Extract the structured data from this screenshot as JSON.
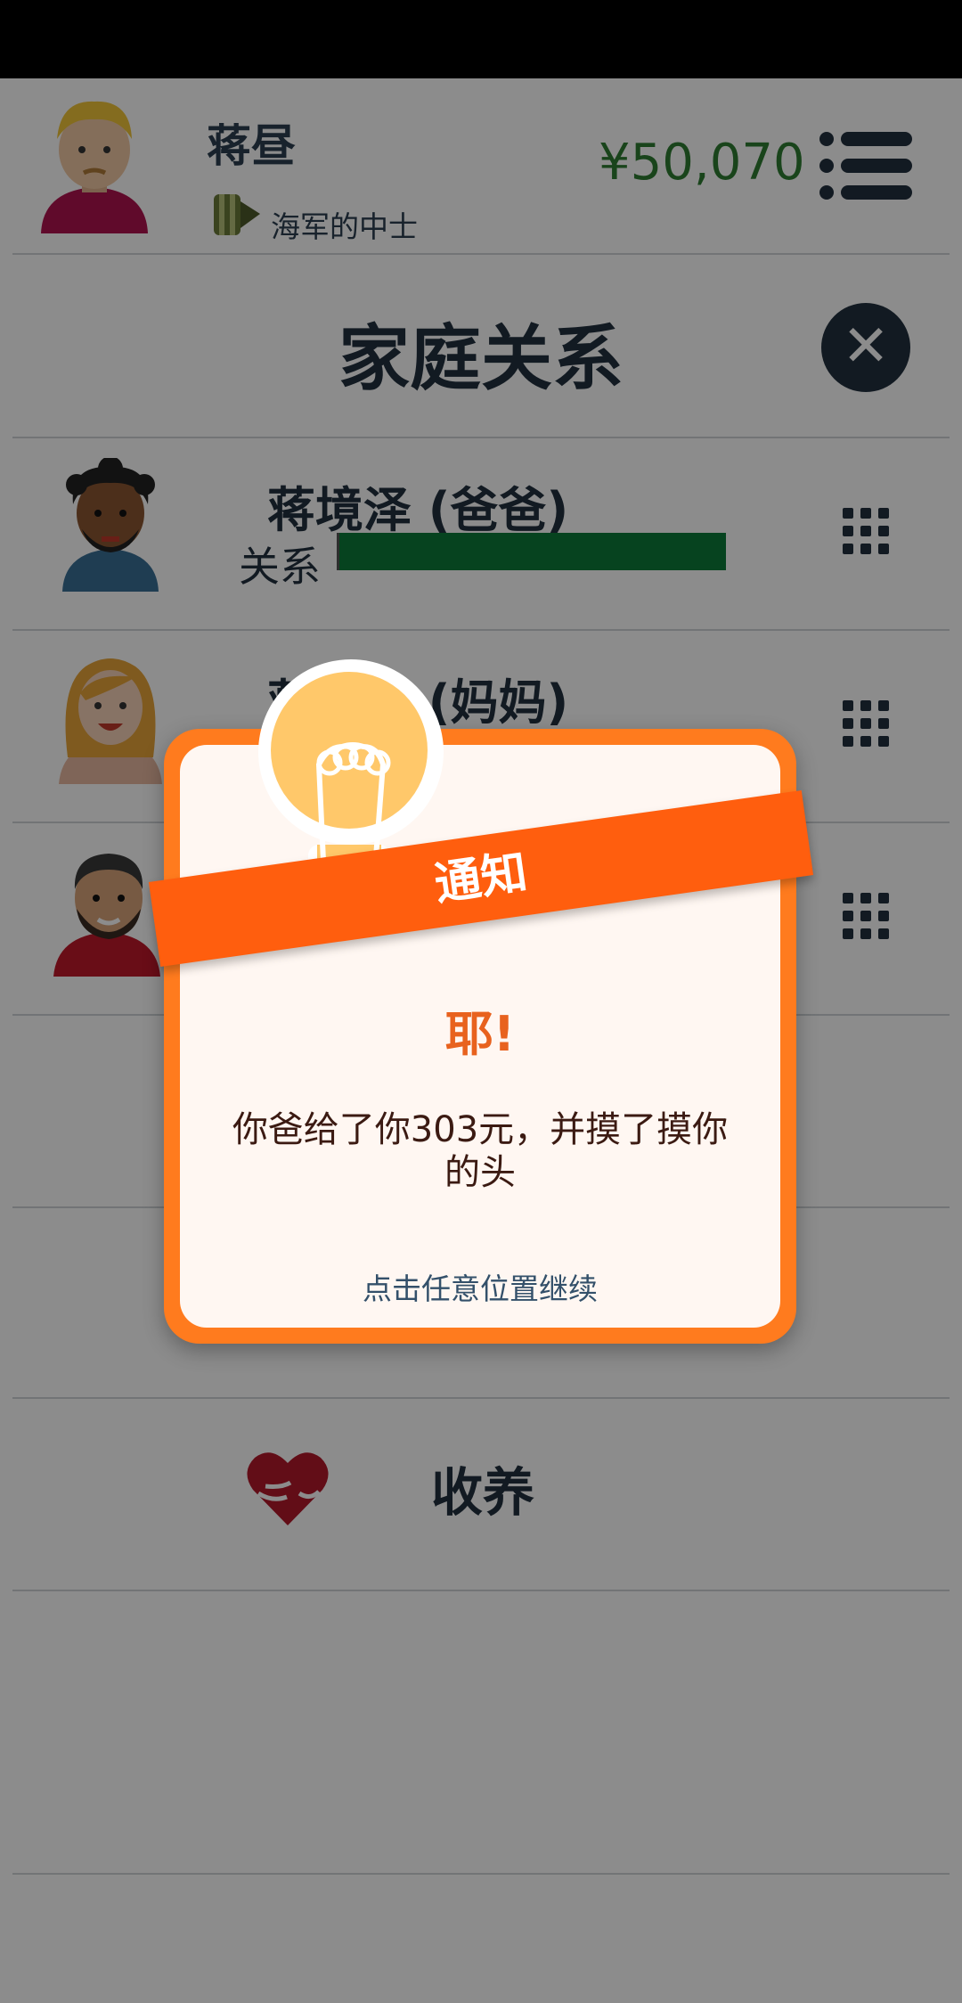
{
  "user": {
    "name": "蒋昼",
    "rank": "海军的中士",
    "money": "¥50,070"
  },
  "page": {
    "title": "家庭关系",
    "close_symbol": "✕"
  },
  "relation_label": "关系",
  "members": [
    {
      "name": "蒋境泽 (爸爸)",
      "relationship": 1.0
    },
    {
      "name": "蒋　泽 (妈妈)",
      "relationship": 1.0
    },
    {
      "name": "",
      "relationship": null
    }
  ],
  "adopt": {
    "label": "收养"
  },
  "notification": {
    "ribbon": "通知",
    "title": "耶!",
    "message": "你爸给了你303元，并摸了摸你的头",
    "hint": "点击任意位置继续"
  },
  "colors": {
    "money": "#2f7d32",
    "relationship_bar": "#0b7a3a",
    "dialog_border": "#ff7b1e",
    "ribbon": "#ff5e0e"
  },
  "icons": {
    "menu": "list-menu-icon",
    "close": "close-icon",
    "member_action": "grid-menu-icon",
    "adopt": "heart-hands-icon",
    "rank": "rank-badge-icon",
    "notification": "lightbulb-icon"
  }
}
